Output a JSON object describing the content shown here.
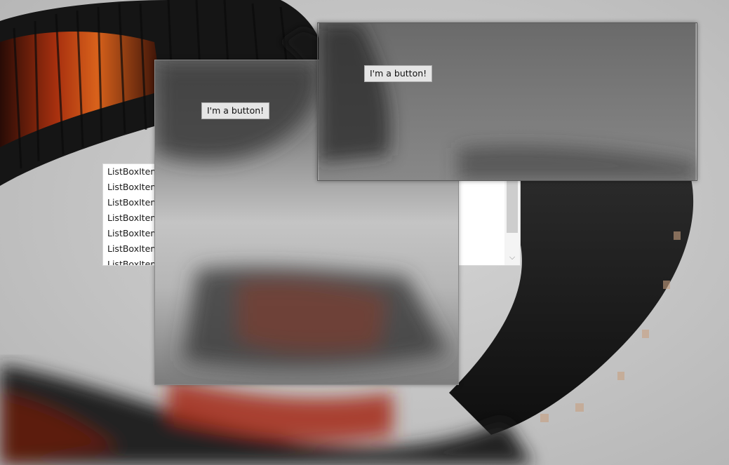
{
  "listbox": {
    "items": [
      "ListBoxItem",
      "ListBoxItem",
      "ListBoxItem",
      "ListBoxItem",
      "ListBoxItem",
      "ListBoxItem",
      "ListBoxItem"
    ],
    "scroll_down_icon": "chevron-down-icon"
  },
  "windows": {
    "left": {
      "button_label": "I'm a button!"
    },
    "right": {
      "button_label": "I'm a button!"
    }
  },
  "colors": {
    "background": "#c6c6c6",
    "listbox_bg": "#ffffff",
    "button_bg": "#e5e5e5",
    "wallpaper_accent": "#e0521a",
    "wallpaper_dark": "#1b1b1b"
  }
}
